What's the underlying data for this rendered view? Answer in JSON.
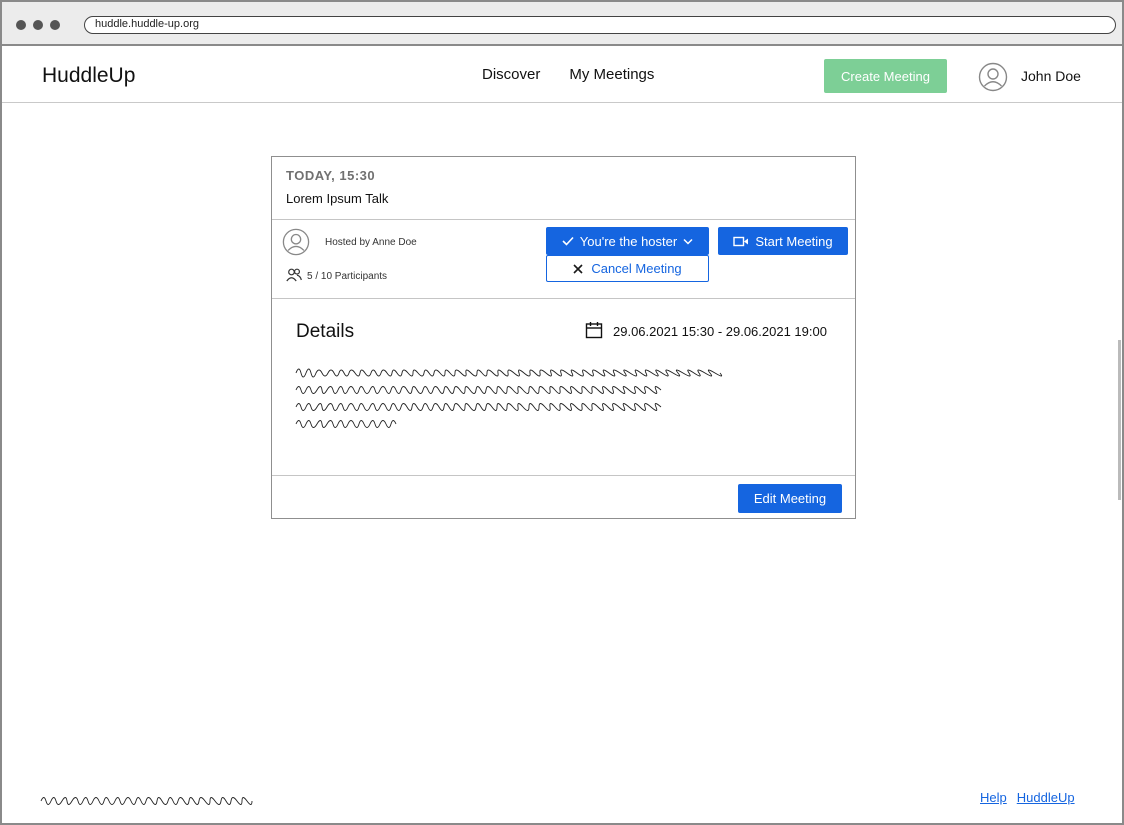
{
  "browser": {
    "url": "huddle.huddle-up.org"
  },
  "header": {
    "logo": "HuddleUp",
    "nav": [
      "Discover",
      "My Meetings"
    ],
    "create_label": "Create Meeting",
    "user_name": "John Doe"
  },
  "meeting": {
    "date_label": "TODAY, 15:30",
    "title": "Lorem Ipsum Talk",
    "host_label": "Hosted by Anne Doe",
    "participants": "5 / 10  Participants",
    "hoster_label": "You're the hoster",
    "start_label": "Start Meeting",
    "cancel_label": "Cancel Meeting",
    "details_title": "Details",
    "details_dates": "29.06.2021 15:30 - 29.06.2021 19:00",
    "edit_label": "Edit Meeting"
  },
  "footer": {
    "links": [
      "Help",
      "HuddleUp"
    ]
  },
  "colors": {
    "primary": "#1565e0",
    "create": "#7dcf96"
  },
  "icons": [
    "user-avatar-icon",
    "participants-icon",
    "check-icon",
    "chevron-down-icon",
    "video-camera-icon",
    "close-icon",
    "calendar-icon"
  ]
}
